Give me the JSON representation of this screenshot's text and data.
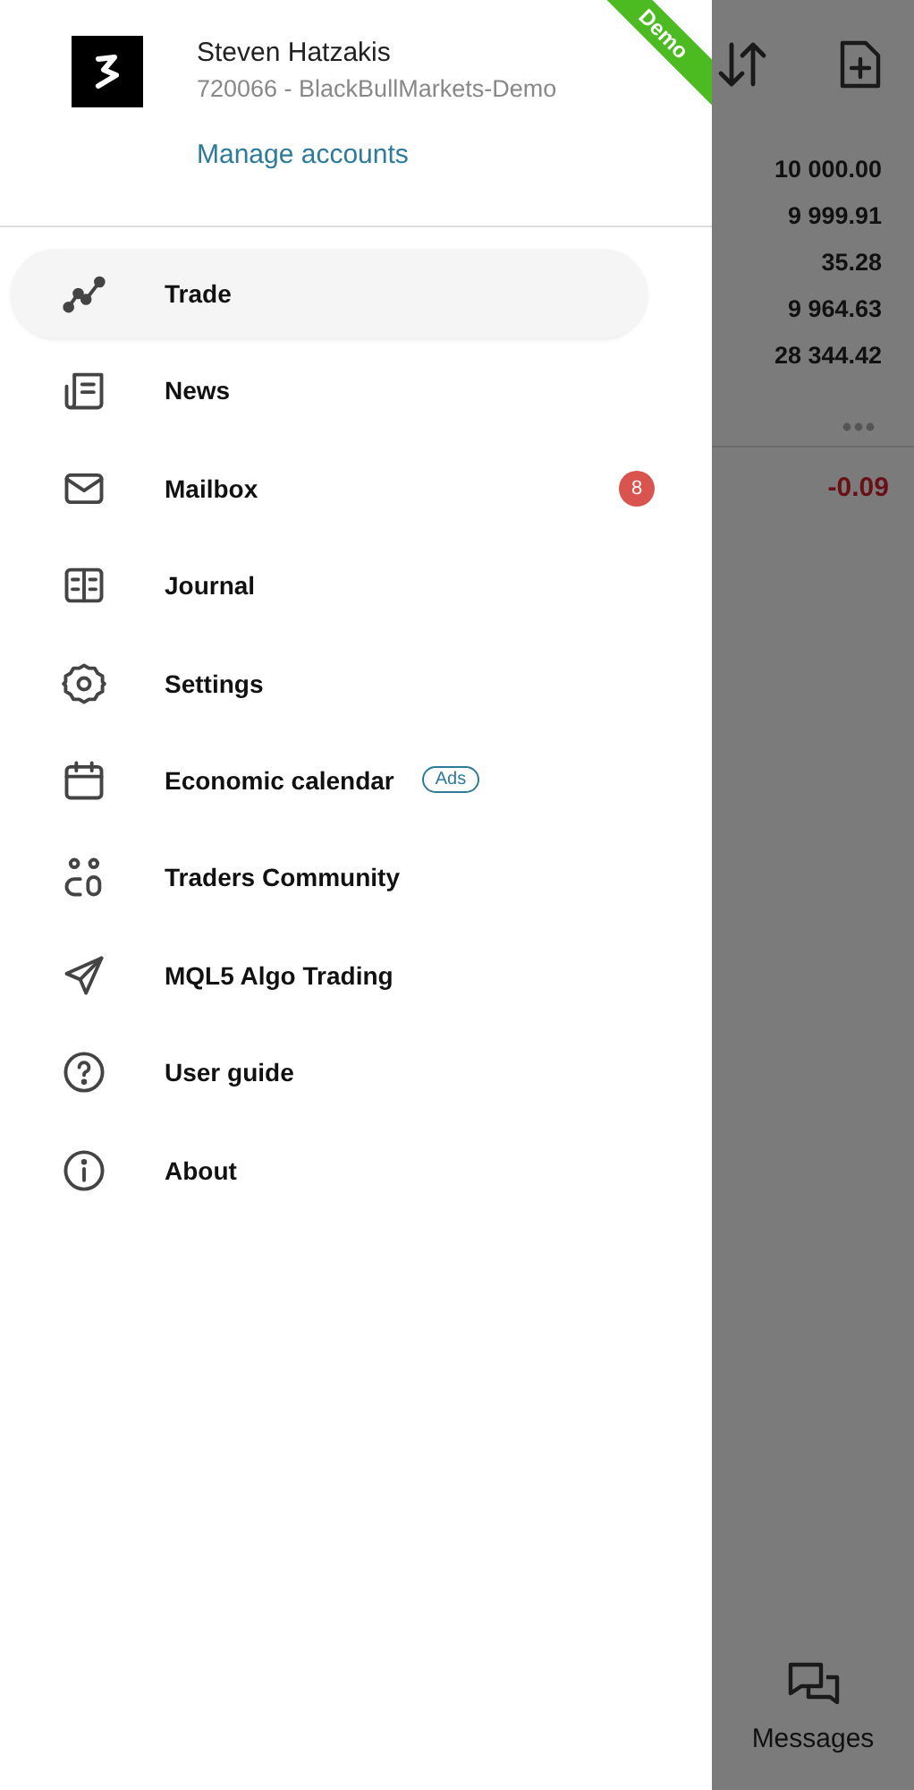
{
  "profile": {
    "name": "Steven Hatzakis",
    "account": "720066 - BlackBullMarkets-Demo",
    "link": "Manage accounts",
    "ribbon": "Demo"
  },
  "menu": [
    {
      "label": "Trade",
      "selected": true
    },
    {
      "label": "News",
      "selected": false
    },
    {
      "label": "Mailbox",
      "selected": false,
      "badge": "8"
    },
    {
      "label": "Journal",
      "selected": false
    },
    {
      "label": "Settings",
      "selected": false
    },
    {
      "label": "Economic calendar",
      "selected": false,
      "tag": "Ads"
    },
    {
      "label": "Traders Community",
      "selected": false
    },
    {
      "label": "MQL5 Algo Trading",
      "selected": false
    },
    {
      "label": "User guide",
      "selected": false
    },
    {
      "label": "About",
      "selected": false
    }
  ],
  "background": {
    "values": [
      "10 000.00",
      "9 999.91",
      "35.28",
      "9 964.63",
      "28 344.42"
    ],
    "profit": "-0.09",
    "messages": "Messages"
  }
}
